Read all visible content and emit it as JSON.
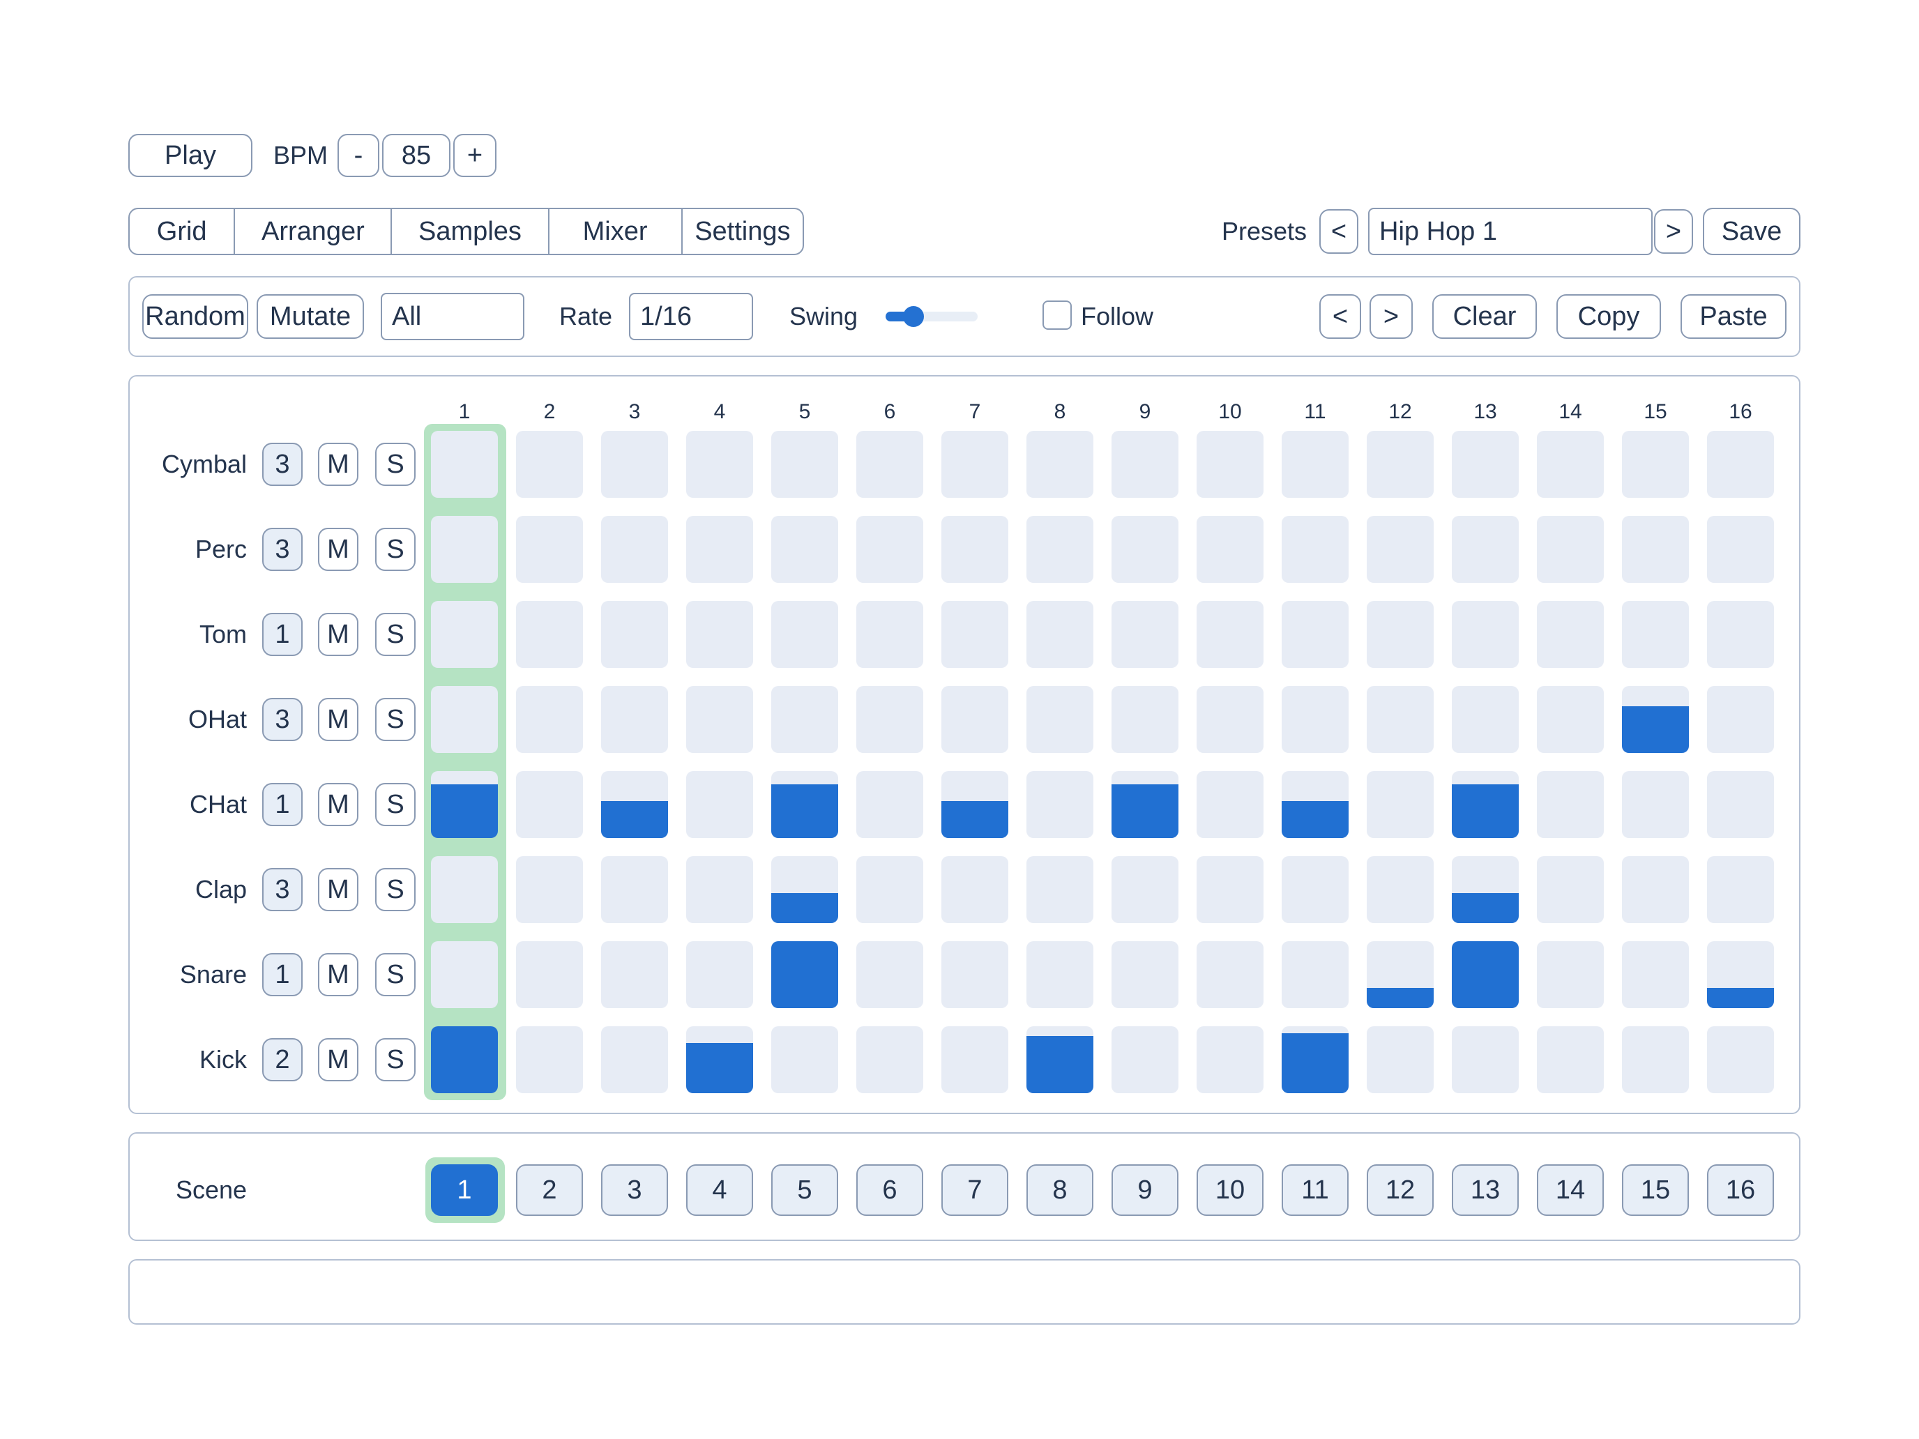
{
  "transport": {
    "play_label": "Play",
    "bpm_label": "BPM",
    "bpm_minus": "-",
    "bpm_value": "85",
    "bpm_plus": "+"
  },
  "tabs": [
    "Grid",
    "Arranger",
    "Samples",
    "Mixer",
    "Settings"
  ],
  "presets": {
    "label": "Presets",
    "prev": "<",
    "value": "Hip Hop 1",
    "next": ">",
    "save": "Save"
  },
  "toolbar": {
    "random": "Random",
    "mutate": "Mutate",
    "target": "All",
    "rate_label": "Rate",
    "rate_value": "1/16",
    "swing_label": "Swing",
    "swing_value": 0.3,
    "follow_label": "Follow",
    "follow_checked": false,
    "prev": "<",
    "next": ">",
    "clear": "Clear",
    "copy": "Copy",
    "paste": "Paste"
  },
  "grid": {
    "columns": [
      "1",
      "2",
      "3",
      "4",
      "5",
      "6",
      "7",
      "8",
      "9",
      "10",
      "11",
      "12",
      "13",
      "14",
      "15",
      "16"
    ],
    "playhead_step": 1,
    "mute_label": "M",
    "solo_label": "S",
    "tracks": [
      {
        "name": "Cymbal",
        "count": "3",
        "steps": [
          0,
          0,
          0,
          0,
          0,
          0,
          0,
          0,
          0,
          0,
          0,
          0,
          0,
          0,
          0,
          0
        ]
      },
      {
        "name": "Perc",
        "count": "3",
        "steps": [
          0,
          0,
          0,
          0,
          0,
          0,
          0,
          0,
          0,
          0,
          0,
          0,
          0,
          0,
          0,
          0
        ]
      },
      {
        "name": "Tom",
        "count": "1",
        "steps": [
          0,
          0,
          0,
          0,
          0,
          0,
          0,
          0,
          0,
          0,
          0,
          0,
          0,
          0,
          0,
          0
        ]
      },
      {
        "name": "OHat",
        "count": "3",
        "steps": [
          0,
          0,
          0,
          0,
          0,
          0,
          0,
          0,
          0,
          0,
          0,
          0,
          0,
          0,
          0.7,
          0
        ]
      },
      {
        "name": "CHat",
        "count": "1",
        "steps": [
          0.8,
          0,
          0.55,
          0,
          0.8,
          0,
          0.55,
          0,
          0.8,
          0,
          0.55,
          0,
          0.8,
          0,
          0,
          0
        ]
      },
      {
        "name": "Clap",
        "count": "3",
        "steps": [
          0,
          0,
          0,
          0,
          0.45,
          0,
          0,
          0,
          0,
          0,
          0,
          0,
          0.45,
          0,
          0,
          0
        ]
      },
      {
        "name": "Snare",
        "count": "1",
        "steps": [
          0,
          0,
          0,
          0,
          1,
          0,
          0,
          0,
          0,
          0,
          0,
          0.3,
          1,
          0,
          0,
          0.3
        ]
      },
      {
        "name": "Kick",
        "count": "2",
        "steps": [
          1,
          0,
          0,
          0.75,
          0,
          0,
          0,
          0.85,
          0,
          0,
          0.9,
          0,
          0,
          0,
          0,
          0
        ]
      }
    ]
  },
  "scenes": {
    "label": "Scene",
    "items": [
      "1",
      "2",
      "3",
      "4",
      "5",
      "6",
      "7",
      "8",
      "9",
      "10",
      "11",
      "12",
      "13",
      "14",
      "15",
      "16"
    ],
    "active": 1
  },
  "colors": {
    "accent": "#2170d2",
    "cell": "#e7ecf5",
    "playhead": "#b5e3c3",
    "border": "#8a9ab3"
  }
}
